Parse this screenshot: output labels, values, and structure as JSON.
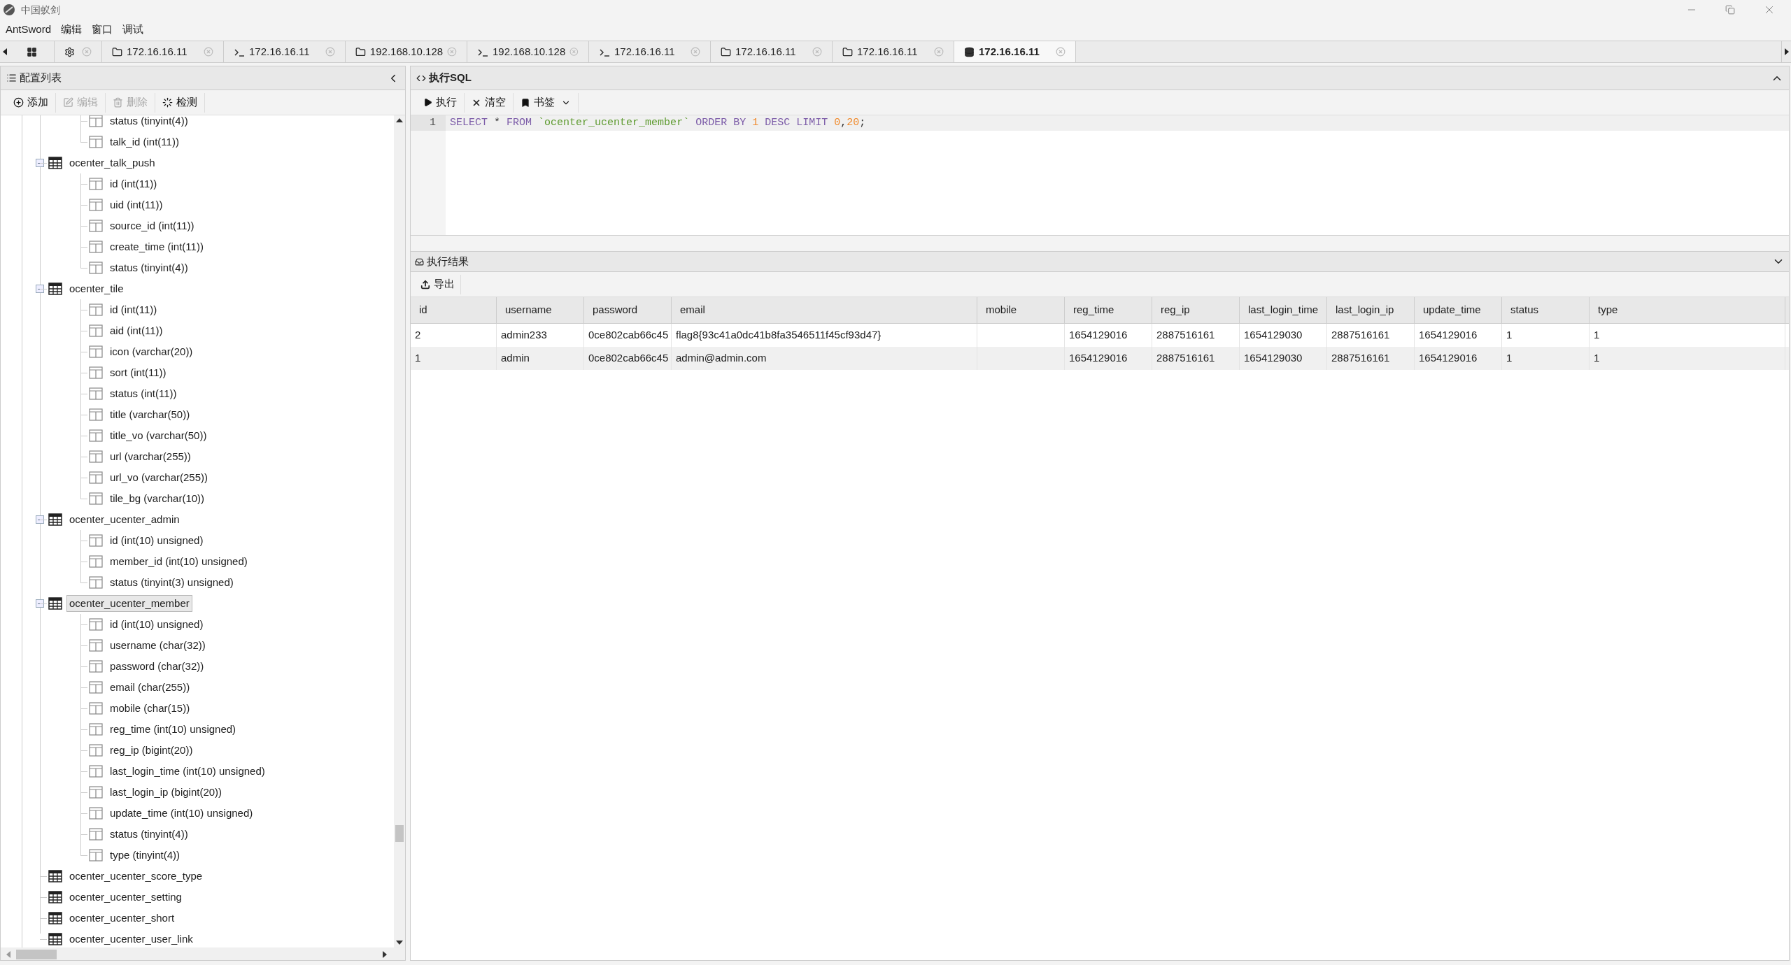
{
  "window": {
    "title": "中国蚁剑"
  },
  "menu": [
    "AntSword",
    "编辑",
    "窗口",
    "调试"
  ],
  "tabs": [
    {
      "kind": "home",
      "closable": false,
      "selected": false
    },
    {
      "kind": "settings",
      "closable": true,
      "selected": false
    },
    {
      "kind": "folder",
      "label": "172.16.16.11",
      "closable": true,
      "selected": false
    },
    {
      "kind": "terminal",
      "label": "172.16.16.11",
      "closable": true,
      "selected": false
    },
    {
      "kind": "folder",
      "label": "192.168.10.128",
      "closable": true,
      "selected": false
    },
    {
      "kind": "terminal",
      "label": "192.168.10.128",
      "closable": true,
      "selected": false
    },
    {
      "kind": "terminal",
      "label": "172.16.16.11",
      "closable": true,
      "selected": false
    },
    {
      "kind": "folder",
      "label": "172.16.16.11",
      "closable": true,
      "selected": false
    },
    {
      "kind": "folder",
      "label": "172.16.16.11",
      "closable": true,
      "selected": false
    },
    {
      "kind": "database",
      "label": "172.16.16.11",
      "closable": true,
      "selected": true
    }
  ],
  "sidebar": {
    "title": "配置列表",
    "toolbar": [
      {
        "kind": "add",
        "label": "添加",
        "disabled": false
      },
      {
        "kind": "edit",
        "label": "编辑",
        "disabled": true
      },
      {
        "kind": "delete",
        "label": "删除",
        "disabled": true
      },
      {
        "kind": "check",
        "label": "检测",
        "disabled": false
      }
    ],
    "tree_top_fields": [
      "status (tinyint(4))",
      "talk_id (int(11))"
    ],
    "tree": [
      {
        "label": "ocenter_talk_push",
        "expanded": true,
        "selected": false,
        "children": [
          "id (int(11))",
          "uid (int(11))",
          "source_id (int(11))",
          "create_time (int(11))",
          "status (tinyint(4))"
        ]
      },
      {
        "label": "ocenter_tile",
        "expanded": true,
        "selected": false,
        "children": [
          "id (int(11))",
          "aid (int(11))",
          "icon (varchar(20))",
          "sort (int(11))",
          "status (int(11))",
          "title (varchar(50))",
          "title_vo (varchar(50))",
          "url (varchar(255))",
          "url_vo (varchar(255))",
          "tile_bg (varchar(10))"
        ]
      },
      {
        "label": "ocenter_ucenter_admin",
        "expanded": true,
        "selected": false,
        "children": [
          "id (int(10) unsigned)",
          "member_id (int(10) unsigned)",
          "status (tinyint(3) unsigned)"
        ]
      },
      {
        "label": "ocenter_ucenter_member",
        "expanded": true,
        "selected": true,
        "children": [
          "id (int(10) unsigned)",
          "username (char(32))",
          "password (char(32))",
          "email (char(255))",
          "mobile (char(15))",
          "reg_time (int(10) unsigned)",
          "reg_ip (bigint(20))",
          "last_login_time (int(10) unsigned)",
          "last_login_ip (bigint(20))",
          "update_time (int(10) unsigned)",
          "status (tinyint(4))",
          "type (tinyint(4))"
        ]
      },
      {
        "label": "ocenter_ucenter_score_type",
        "expanded": false,
        "selected": false
      },
      {
        "label": "ocenter_ucenter_setting",
        "expanded": false,
        "selected": false
      },
      {
        "label": "ocenter_ucenter_short",
        "expanded": false,
        "selected": false
      },
      {
        "label": "ocenter_ucenter_user_link",
        "expanded": false,
        "selected": false
      }
    ]
  },
  "sql_panel": {
    "title": "执行SQL",
    "toolbar": [
      {
        "kind": "run",
        "label": "执行"
      },
      {
        "kind": "clear",
        "label": "清空"
      },
      {
        "kind": "bookmark",
        "label": "书签"
      }
    ],
    "line_number": "1",
    "words": [
      [
        {
          "kind": "keyword",
          "text": "SELECT"
        }
      ],
      [
        {
          "kind": "plain",
          "text": "*"
        }
      ],
      [
        {
          "kind": "keyword",
          "text": "FROM"
        }
      ],
      [
        {
          "kind": "string",
          "text": "`ocenter_ucenter_member`"
        }
      ],
      [
        {
          "kind": "keyword",
          "text": "ORDER BY"
        }
      ],
      [
        {
          "kind": "number",
          "text": "1"
        }
      ],
      [
        {
          "kind": "keyword",
          "text": "DESC LIMIT"
        }
      ],
      [
        {
          "kind": "number",
          "text": "0"
        },
        {
          "kind": "plain",
          "text": ","
        },
        {
          "kind": "number",
          "text": "20"
        },
        {
          "kind": "plain",
          "text": ";"
        }
      ]
    ]
  },
  "result_panel": {
    "title": "执行结果",
    "export": "导出",
    "columns": [
      "id",
      "username",
      "password",
      "email",
      "mobile",
      "reg_time",
      "reg_ip",
      "last_login_time",
      "last_login_ip",
      "update_time",
      "status",
      "type"
    ],
    "rows": [
      [
        "2",
        "admin233",
        "0ce802cab66c45",
        "flag8{93c41a0dc41b8fa3546511f45cf93d47}",
        "",
        "1654129016",
        "2887516161",
        "1654129030",
        "2887516161",
        "1654129016",
        "1",
        "1"
      ],
      [
        "1",
        "admin",
        "0ce802cab66c45",
        "admin@admin.com",
        "",
        "1654129016",
        "2887516161",
        "1654129030",
        "2887516161",
        "1654129016",
        "1",
        "1"
      ]
    ]
  }
}
